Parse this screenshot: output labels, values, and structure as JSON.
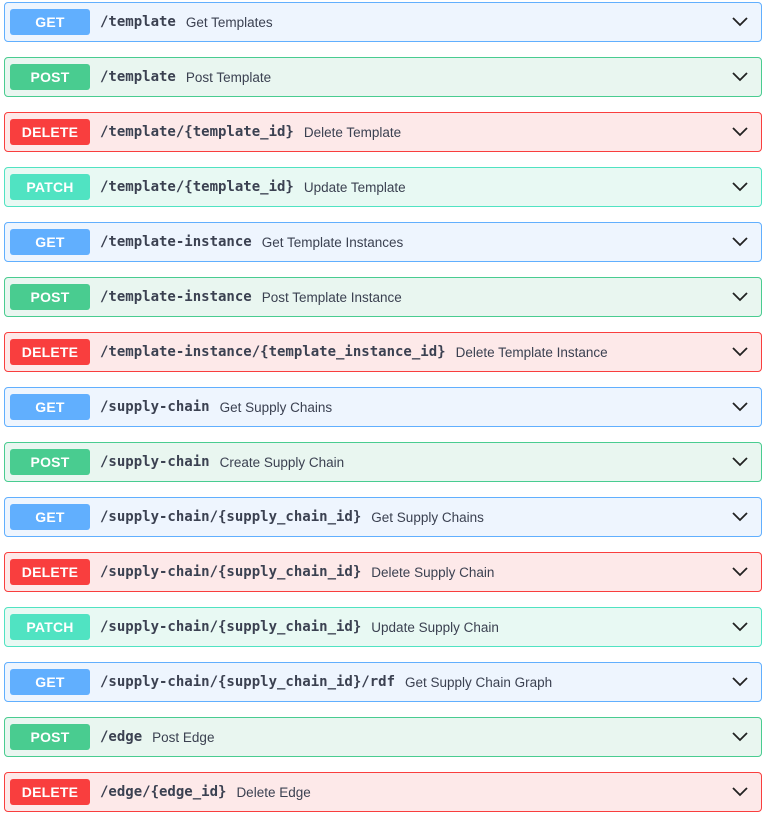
{
  "operations": [
    {
      "method": "GET",
      "path": "/template",
      "summary": "Get Templates"
    },
    {
      "method": "POST",
      "path": "/template",
      "summary": "Post Template"
    },
    {
      "method": "DELETE",
      "path": "/template/{template_id}",
      "summary": "Delete Template"
    },
    {
      "method": "PATCH",
      "path": "/template/{template_id}",
      "summary": "Update Template"
    },
    {
      "method": "GET",
      "path": "/template-instance",
      "summary": "Get Template Instances"
    },
    {
      "method": "POST",
      "path": "/template-instance",
      "summary": "Post Template Instance"
    },
    {
      "method": "DELETE",
      "path": "/template-instance/{template_instance_id}",
      "summary": "Delete Template Instance"
    },
    {
      "method": "GET",
      "path": "/supply-chain",
      "summary": "Get Supply Chains"
    },
    {
      "method": "POST",
      "path": "/supply-chain",
      "summary": "Create Supply Chain"
    },
    {
      "method": "GET",
      "path": "/supply-chain/{supply_chain_id}",
      "summary": "Get Supply Chains"
    },
    {
      "method": "DELETE",
      "path": "/supply-chain/{supply_chain_id}",
      "summary": "Delete Supply Chain"
    },
    {
      "method": "PATCH",
      "path": "/supply-chain/{supply_chain_id}",
      "summary": "Update Supply Chain"
    },
    {
      "method": "GET",
      "path": "/supply-chain/{supply_chain_id}/rdf",
      "summary": "Get Supply Chain Graph"
    },
    {
      "method": "POST",
      "path": "/edge",
      "summary": "Post Edge"
    },
    {
      "method": "DELETE",
      "path": "/edge/{edge_id}",
      "summary": "Delete Edge"
    }
  ],
  "icons": {
    "expand": "chevron-down-icon"
  },
  "colors": {
    "get": "#61affe",
    "post": "#49cc90",
    "delete": "#f93e3e",
    "patch": "#50e3c2",
    "text": "#3b4151"
  }
}
